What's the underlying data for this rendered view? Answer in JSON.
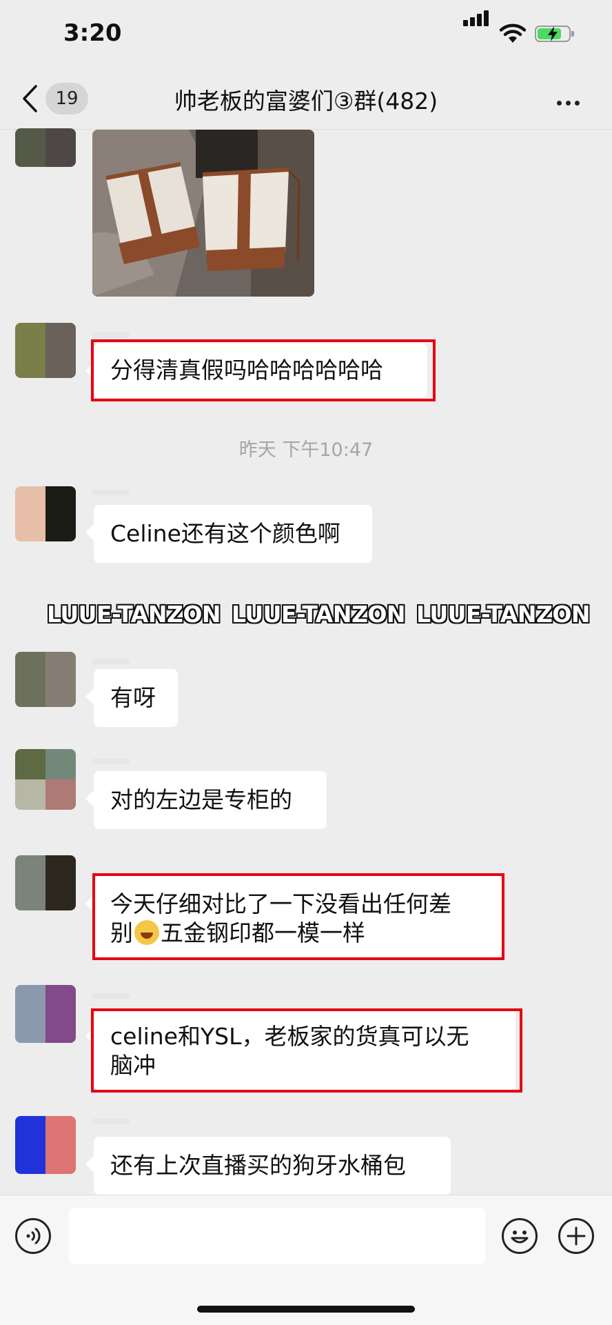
{
  "status_bar": {
    "time": "3:20"
  },
  "nav": {
    "unread_count": "19",
    "title": "帅老板的富婆们③群(482)"
  },
  "messages": [
    {
      "id": "photo",
      "avatar_colors": [
        "#555a48",
        "#4d4845"
      ]
    },
    {
      "id": "m1",
      "avatar_colors": [
        "#7a7f4a",
        "#6a625a"
      ],
      "text": "分得清真假吗哈哈哈哈哈哈",
      "highlighted": true
    },
    {
      "id": "m2",
      "avatar_colors": [
        "#e7bfa9",
        "#1c1c16"
      ],
      "text": "Celine还有这个颜色啊",
      "highlighted": false
    },
    {
      "id": "m3",
      "avatar_colors": [
        "#6d715b",
        "#857d73"
      ],
      "text": "有呀",
      "highlighted": false
    },
    {
      "id": "m4",
      "avatar_colors": [
        "#5e6a44",
        "#74887a",
        "#b6b7a4",
        "#ad7a75"
      ],
      "text": "对的左边是专柜的",
      "highlighted": false
    },
    {
      "id": "m5",
      "avatar_colors": [
        "#7c8479",
        "#2d281f"
      ],
      "text_line1": "今天仔细对比了一下没看出任何差",
      "text_line2_a": "别",
      "text_line2_b": "五金钢印都一模一样",
      "emoji": "laughing-crying-emoji",
      "highlighted": true
    },
    {
      "id": "m6",
      "avatar_colors": [
        "#8a99ae",
        "#834a8a"
      ],
      "text_line1": "celine和YSL，老板家的货真可以无",
      "text_line2": "脑冲",
      "highlighted": true
    },
    {
      "id": "m7",
      "avatar_colors": [
        "#2133d8",
        "#de7474"
      ],
      "text": "还有上次直播买的狗牙水桶包",
      "highlighted": false
    }
  ],
  "timestamp": "昨天 下午10:47",
  "watermark": "LUUE-TANZON",
  "input_bar": {
    "placeholder": ""
  },
  "icons": {
    "back": "chevron-left-icon",
    "more": "more-dots-icon",
    "voice": "voice-icon",
    "emoji": "emoji-icon",
    "plus": "plus-icon"
  },
  "colors": {
    "highlight_border": "#e60012",
    "chat_background": "#ededed",
    "battery": "#4cd964"
  }
}
